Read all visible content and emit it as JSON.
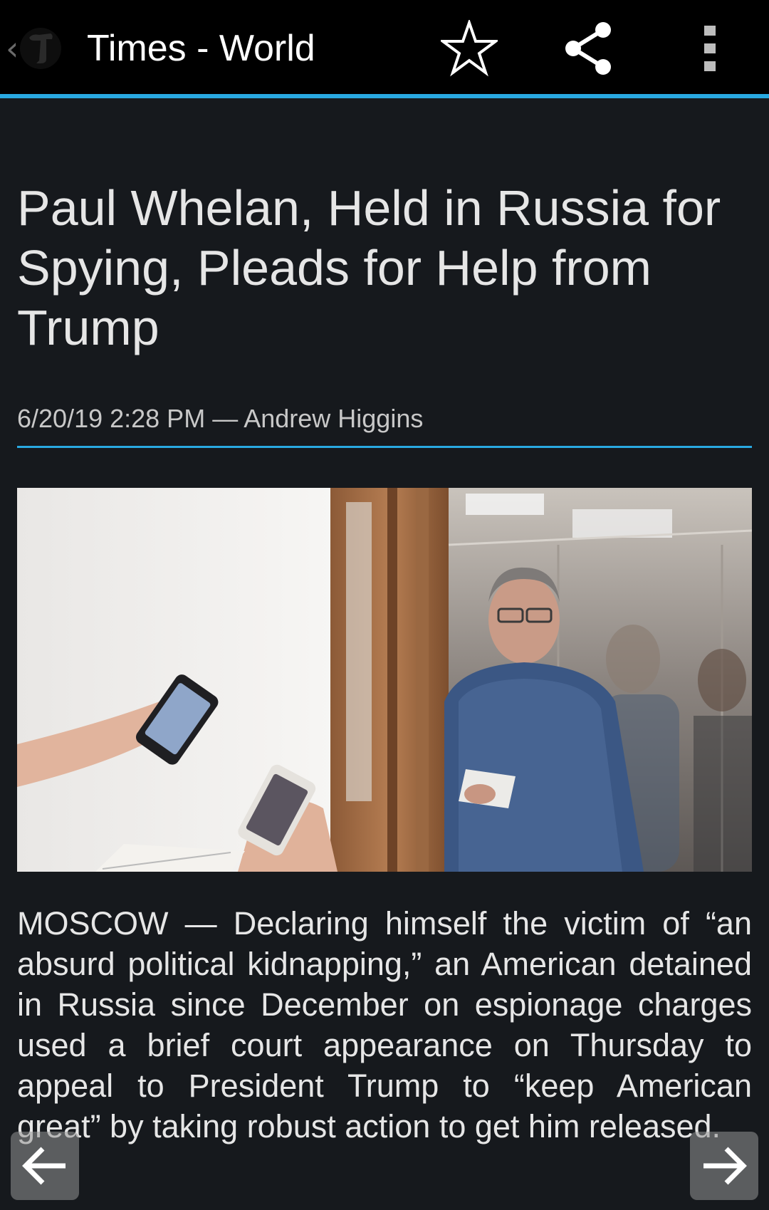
{
  "app_bar": {
    "title": "Times - World",
    "back_icon": "chevron-left-icon",
    "logo": "nyt-t-logo",
    "actions": [
      {
        "name": "favorite",
        "icon": "star-outline-icon"
      },
      {
        "name": "share",
        "icon": "share-icon"
      },
      {
        "name": "overflow-menu",
        "icon": "more-vert-icon"
      }
    ]
  },
  "article": {
    "headline": "Paul Whelan, Held in Russia for Spying, Pleads for Help from Trump",
    "date": "6/20/19 2:28 PM",
    "separator": "—",
    "author": "Andrew Higgins",
    "image_alt": "",
    "body": "MOSCOW — Declaring himself the victim of “an absurd political kidnapping,” an American detained in Russia since December on espionage charges used a brief court appearance on Thursday to appeal to President Trump to “keep American great” by taking robust action to get him released."
  },
  "navigation": {
    "prev_icon": "arrow-left-icon",
    "next_icon": "arrow-right-icon"
  },
  "colors": {
    "accent": "#29a9e1",
    "background": "#16191d",
    "app_bar": "#000000",
    "text": "#e6e6e6"
  }
}
